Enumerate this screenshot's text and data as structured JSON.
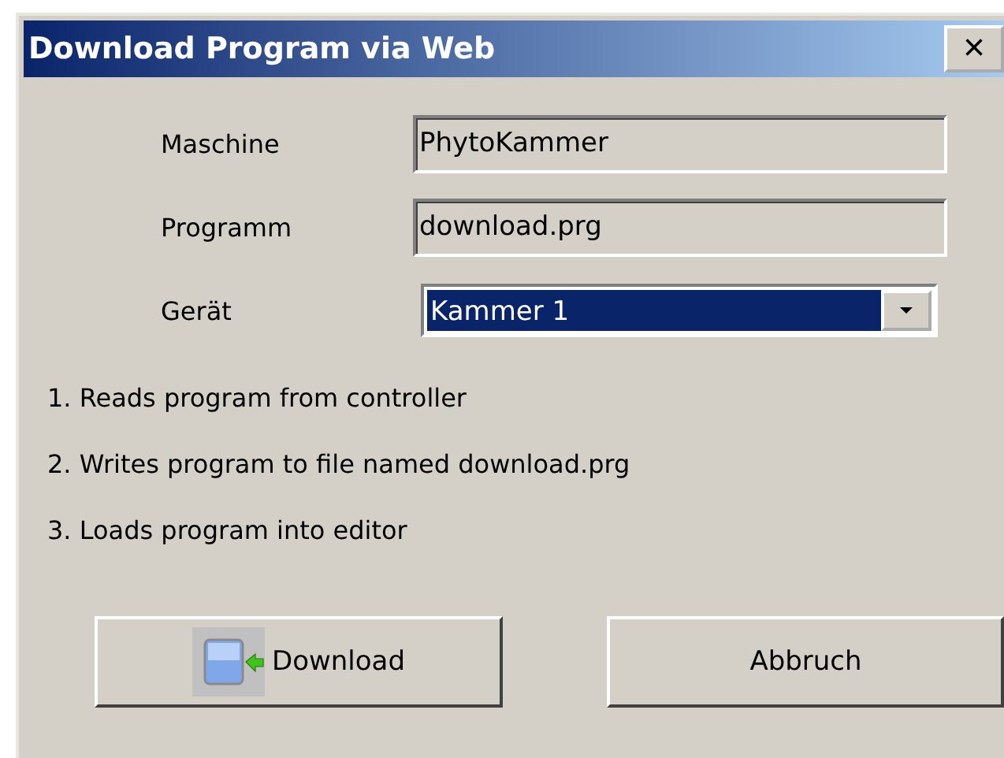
{
  "window": {
    "title": "Download Program via Web",
    "close": "×"
  },
  "fields": [
    {
      "label": "Maschine",
      "value": "PhytoKammer"
    },
    {
      "label": "Programm",
      "value": "download.prg"
    }
  ],
  "device": {
    "label": "Gerät",
    "value": "Kammer 1",
    "selected": true
  },
  "steps": [
    "1. Reads program from controller",
    "2. Writes program to file named download.prg",
    "3. Loads program into editor"
  ],
  "buttons": [
    {
      "label": "Download",
      "kind": "download"
    },
    {
      "label": "Abbruch",
      "kind": "plain"
    }
  ]
}
